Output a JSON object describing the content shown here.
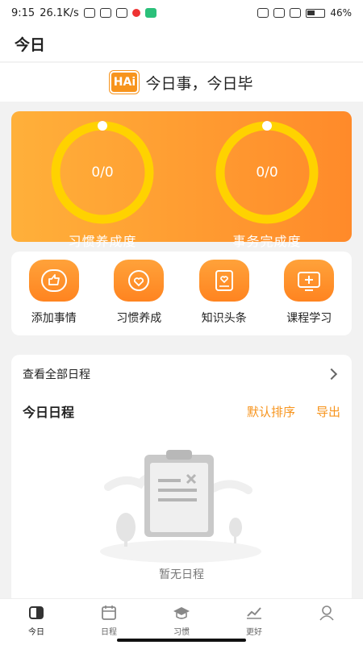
{
  "status_bar": {
    "time": "9:15",
    "net_speed": "26.1K/s",
    "battery": "46%"
  },
  "header": {
    "title": "今日"
  },
  "slogan": {
    "logo_text": "HAi",
    "text": "今日事，今日毕"
  },
  "progress": {
    "habit": {
      "value": "0/0",
      "label": "习惯养成度"
    },
    "task": {
      "value": "0/0",
      "label": "事务完成度"
    }
  },
  "quick_actions": [
    {
      "label": "添加事情",
      "icon": "thumbs-up-icon"
    },
    {
      "label": "习惯养成",
      "icon": "heart-people-icon"
    },
    {
      "label": "知识头条",
      "icon": "notebook-heart-icon"
    },
    {
      "label": "课程学习",
      "icon": "plus-screen-icon"
    }
  ],
  "schedule": {
    "view_all": "查看全部日程",
    "today_title": "今日日程",
    "sort_label": "默认排序",
    "export_label": "导出",
    "empty_text": "暂无日程"
  },
  "tabs": [
    {
      "label": "今日",
      "icon": "today-icon",
      "active": true
    },
    {
      "label": "日程",
      "icon": "calendar-icon",
      "active": false
    },
    {
      "label": "习惯",
      "icon": "graduation-cap-icon",
      "active": false
    },
    {
      "label": "更好",
      "icon": "trend-chart-icon",
      "active": false
    },
    {
      "label": "",
      "icon": "profile-icon",
      "active": false
    }
  ],
  "colors": {
    "accent": "#f7941d",
    "ring": "#ffd200"
  }
}
